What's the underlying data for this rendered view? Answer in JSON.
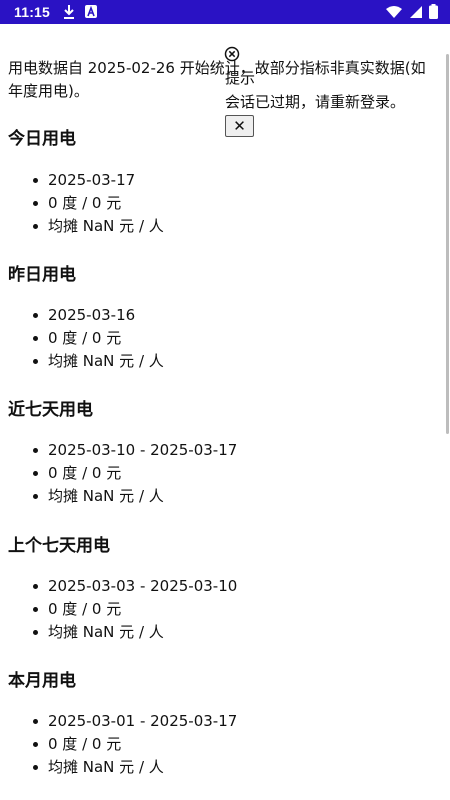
{
  "status_bar": {
    "time": "11:15",
    "icons": [
      "download-icon",
      "a-icon",
      "wifi-icon",
      "signal-icon",
      "battery-icon"
    ],
    "background": "#2a12c4"
  },
  "intro": "用电数据自 2025-02-26 开始统计，故部分指标非真实数据(如年度用电)。",
  "sections": [
    {
      "title": "今日用电",
      "items": [
        "2025-03-17",
        "0 度 / 0 元",
        "均摊 NaN 元 / 人"
      ]
    },
    {
      "title": "昨日用电",
      "items": [
        "2025-03-16",
        "0 度 / 0 元",
        "均摊 NaN 元 / 人"
      ]
    },
    {
      "title": "近七天用电",
      "items": [
        "2025-03-10 - 2025-03-17",
        "0 度 / 0 元",
        "均摊 NaN 元 / 人"
      ]
    },
    {
      "title": "上个七天用电",
      "items": [
        "2025-03-03 - 2025-03-10",
        "0 度 / 0 元",
        "均摊 NaN 元 / 人"
      ]
    },
    {
      "title": "本月用电",
      "items": [
        "2025-03-01 - 2025-03-17",
        "0 度 / 0 元",
        "均摊 NaN 元 / 人"
      ]
    }
  ],
  "dialog": {
    "icon": "circle-x-icon",
    "title": "提示",
    "message": "会话已过期，请重新登录。",
    "close_label": "✕"
  }
}
